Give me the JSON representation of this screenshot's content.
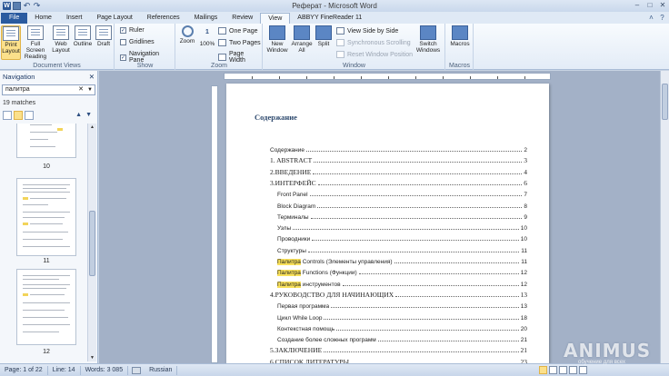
{
  "window": {
    "title": "Реферат - Microsoft Word",
    "app_icon": "W",
    "controls": [
      "minimize-icon",
      "maximize-icon",
      "close-icon"
    ]
  },
  "tabs": [
    "File",
    "Home",
    "Insert",
    "Page Layout",
    "References",
    "Mailings",
    "Review",
    "View",
    "ABBYY FineReader 11"
  ],
  "active_tab": "View",
  "ribbon": {
    "document_views": {
      "label": "Document Views",
      "buttons": [
        "Print Layout",
        "Full Screen Reading",
        "Web Layout",
        "Outline",
        "Draft"
      ],
      "selected": "Print Layout"
    },
    "show": {
      "label": "Show",
      "checks": [
        {
          "label": "Ruler",
          "checked": true
        },
        {
          "label": "Gridlines",
          "checked": false
        },
        {
          "label": "Navigation Pane",
          "checked": true
        }
      ]
    },
    "zoom": {
      "label": "Zoom",
      "buttons": [
        "Zoom",
        "100%"
      ],
      "small": [
        "One Page",
        "Two Pages",
        "Page Width"
      ]
    },
    "window_group": {
      "label": "Window",
      "buttons": [
        "New Window",
        "Arrange All",
        "Split"
      ],
      "small": [
        {
          "label": "View Side by Side",
          "enabled": true
        },
        {
          "label": "Synchronous Scrolling",
          "enabled": false
        },
        {
          "label": "Reset Window Position",
          "enabled": false
        }
      ],
      "switch": "Switch Windows"
    },
    "macros": {
      "label": "Macros",
      "button": "Macros"
    }
  },
  "navigation": {
    "title": "Navigation",
    "search_value": "палитра",
    "matches": "19 matches",
    "pages": [
      "10",
      "11",
      "12"
    ]
  },
  "document": {
    "heading": "Содержание",
    "toc": [
      {
        "text": "Содержание",
        "page": "2",
        "level": 1,
        "serif": false
      },
      {
        "text": "1. ABSTRACT",
        "page": "3",
        "level": 1,
        "serif": true
      },
      {
        "text": "2.ВВЕДЕНИЕ",
        "page": "4",
        "level": 1,
        "serif": true
      },
      {
        "text": "3.ИНТЕРФЕЙС",
        "page": "6",
        "level": 1,
        "serif": true
      },
      {
        "text": "Front Panel",
        "page": "7",
        "level": 2,
        "serif": false
      },
      {
        "text": "Block Diagram",
        "page": "8",
        "level": 2,
        "serif": false
      },
      {
        "text": "Терминалы",
        "page": "9",
        "level": 2,
        "serif": false
      },
      {
        "text": "Узлы",
        "page": "10",
        "level": 2,
        "serif": false
      },
      {
        "text": "Проводники",
        "page": "10",
        "level": 2,
        "serif": false
      },
      {
        "text": "Структуры",
        "page": "11",
        "level": 2,
        "serif": false
      },
      {
        "text": " Controls (Элементы управления)",
        "highlight": "Палитра",
        "page": "11",
        "level": 2,
        "serif": false
      },
      {
        "text": " Functions (Функции)",
        "highlight": "Палитра",
        "page": "12",
        "level": 2,
        "serif": false
      },
      {
        "text": " инструментов",
        "highlight": "Палитра",
        "page": "12",
        "level": 2,
        "serif": false
      },
      {
        "text": "4.РУКОВОДСТВО ДЛЯ НАЧИНАЮЩИХ",
        "page": "13",
        "level": 1,
        "serif": true
      },
      {
        "text": "Первая программа",
        "page": "13",
        "level": 2,
        "serif": false
      },
      {
        "text": "Цикл While Loop",
        "page": "18",
        "level": 2,
        "serif": false
      },
      {
        "text": "Контекстная помощь",
        "page": "20",
        "level": 2,
        "serif": false
      },
      {
        "text": "Создание более сложных программ",
        "page": "21",
        "level": 2,
        "serif": false
      },
      {
        "text": "5.ЗАКЛЮЧЕНИЕ",
        "page": "21",
        "level": 1,
        "serif": true
      },
      {
        "text": "6.СПИСОК ЛИТЕРАТУРЫ",
        "page": "23",
        "level": 1,
        "serif": true
      }
    ]
  },
  "status": {
    "page": "Page: 1 of 22",
    "line": "Line: 14",
    "words": "Words: 3 085",
    "language": "Russian"
  },
  "watermark": {
    "text": "ANIMUS",
    "sub": "обучение для всех"
  }
}
